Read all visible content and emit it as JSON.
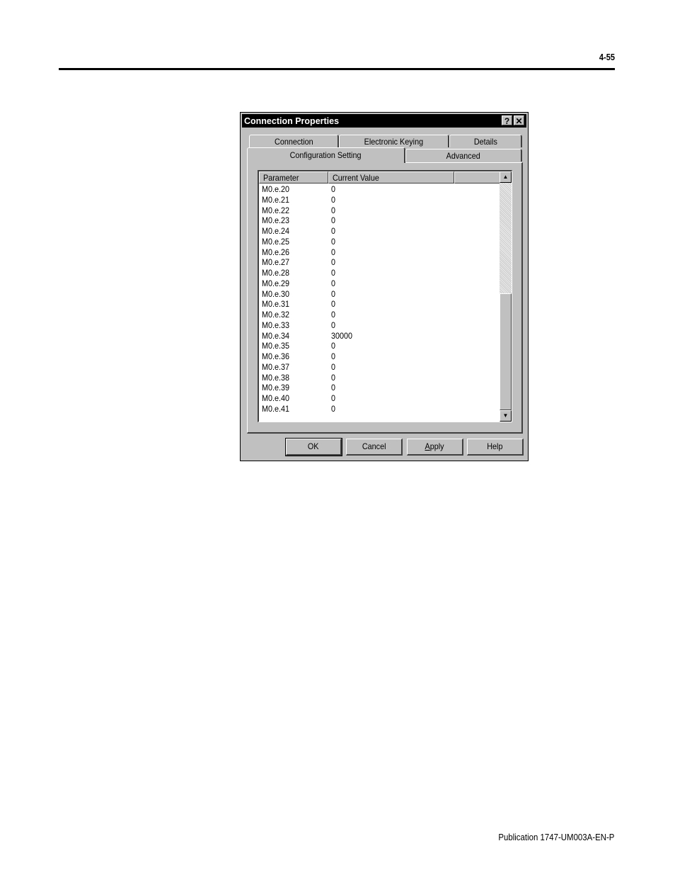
{
  "page": {
    "page_number": "4-55",
    "footer": "Publication 1747-UM003A-EN-P"
  },
  "dialog": {
    "title": "Connection Properties",
    "help_glyph": "?",
    "close_glyph": "✕",
    "tabs_back_row": [
      "Connection",
      "Electronic Keying",
      "Details"
    ],
    "tabs_front_row": [
      "Configuration Setting",
      "Advanced"
    ],
    "active_tab": "Configuration Setting",
    "list": {
      "columns": [
        "Parameter",
        "Current Value",
        ""
      ],
      "rows": [
        {
          "parameter": "M0.e.20",
          "value": "0"
        },
        {
          "parameter": "M0.e.21",
          "value": "0"
        },
        {
          "parameter": "M0.e.22",
          "value": "0"
        },
        {
          "parameter": "M0.e.23",
          "value": "0"
        },
        {
          "parameter": "M0.e.24",
          "value": "0"
        },
        {
          "parameter": "M0.e.25",
          "value": "0"
        },
        {
          "parameter": "M0.e.26",
          "value": "0"
        },
        {
          "parameter": "M0.e.27",
          "value": "0"
        },
        {
          "parameter": "M0.e.28",
          "value": "0"
        },
        {
          "parameter": "M0.e.29",
          "value": "0"
        },
        {
          "parameter": "M0.e.30",
          "value": "0"
        },
        {
          "parameter": "M0.e.31",
          "value": "0"
        },
        {
          "parameter": "M0.e.32",
          "value": "0"
        },
        {
          "parameter": "M0.e.33",
          "value": "0"
        },
        {
          "parameter": "M0.e.34",
          "value": "30000"
        },
        {
          "parameter": "M0.e.35",
          "value": "0"
        },
        {
          "parameter": "M0.e.36",
          "value": "0"
        },
        {
          "parameter": "M0.e.37",
          "value": "0"
        },
        {
          "parameter": "M0.e.38",
          "value": "0"
        },
        {
          "parameter": "M0.e.39",
          "value": "0"
        },
        {
          "parameter": "M0.e.40",
          "value": "0"
        },
        {
          "parameter": "M0.e.41",
          "value": "0"
        }
      ],
      "scroll_up_glyph": "▲",
      "scroll_down_glyph": "▼"
    },
    "buttons": {
      "ok": "OK",
      "cancel": "Cancel",
      "apply": "Apply",
      "help": "Help"
    }
  }
}
